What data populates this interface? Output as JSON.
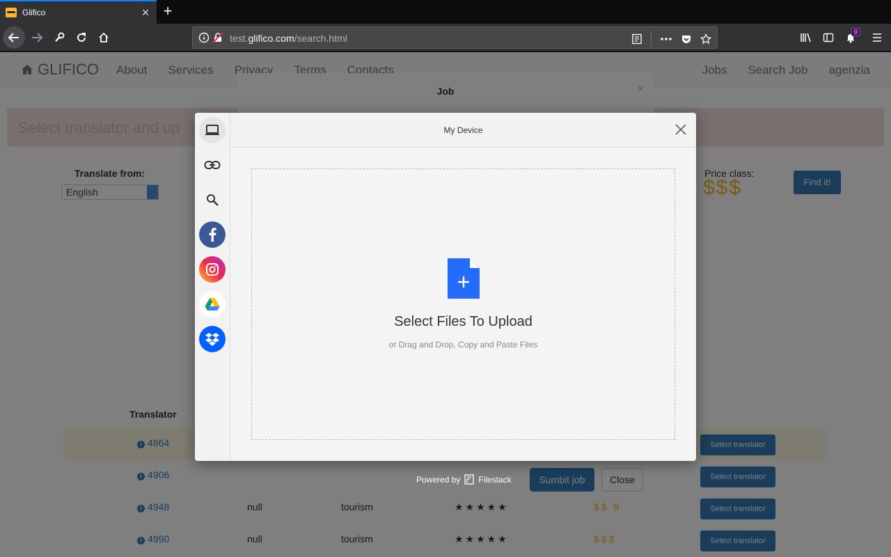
{
  "browser": {
    "tab_title": "Glifico",
    "tab_close": "×",
    "new_tab": "+",
    "url_prefix": "test.",
    "url_domain": "glifico.com",
    "url_path": "/search.html",
    "notification_count": "0"
  },
  "site": {
    "brand": "GLIFICO",
    "nav_links": [
      "About",
      "Services",
      "Privacy",
      "Terms",
      "Contacts"
    ],
    "nav_right": [
      "Jobs",
      "Search Job",
      "agenzia"
    ],
    "alert_text": "Select translator and up",
    "translate_from_label": "Translate from:",
    "translate_from_value": "English",
    "price_class_label": "Price class:",
    "price_class_value": "$$$",
    "find_button": "Find it!",
    "table_header_translator": "Translator",
    "rows": [
      {
        "id": "4864",
        "name": "",
        "field": "",
        "stars": "",
        "price": "",
        "button": "Select translator"
      },
      {
        "id": "4906",
        "name": "",
        "field": "",
        "stars": "",
        "price": "",
        "button": "Select translator"
      },
      {
        "id": "4948",
        "name": "null",
        "field": "tourism",
        "stars": "★★★★★",
        "price": "$$ 9",
        "button": "Select translator"
      },
      {
        "id": "4990",
        "name": "null",
        "field": "tourism",
        "stars": "★★★★★",
        "price": "$$$",
        "button": "Select translator"
      }
    ]
  },
  "job_modal": {
    "title": "Job",
    "close": "×",
    "submit_button": "Sumbit job",
    "close_button": "Close"
  },
  "picker": {
    "title": "My Device",
    "drop_title": "Select Files To Upload",
    "drop_subtitle": "or Drag and Drop, Copy and Paste Files",
    "powered_by": "Powered by",
    "powered_brand": "Filestack",
    "sources": [
      "device-icon",
      "link-icon",
      "search-icon",
      "facebook-icon",
      "instagram-icon",
      "google-drive-icon",
      "dropbox-icon"
    ],
    "accent_color": "#246bff",
    "facebook_color": "#3b5998",
    "dropbox_color": "#0061ff"
  }
}
